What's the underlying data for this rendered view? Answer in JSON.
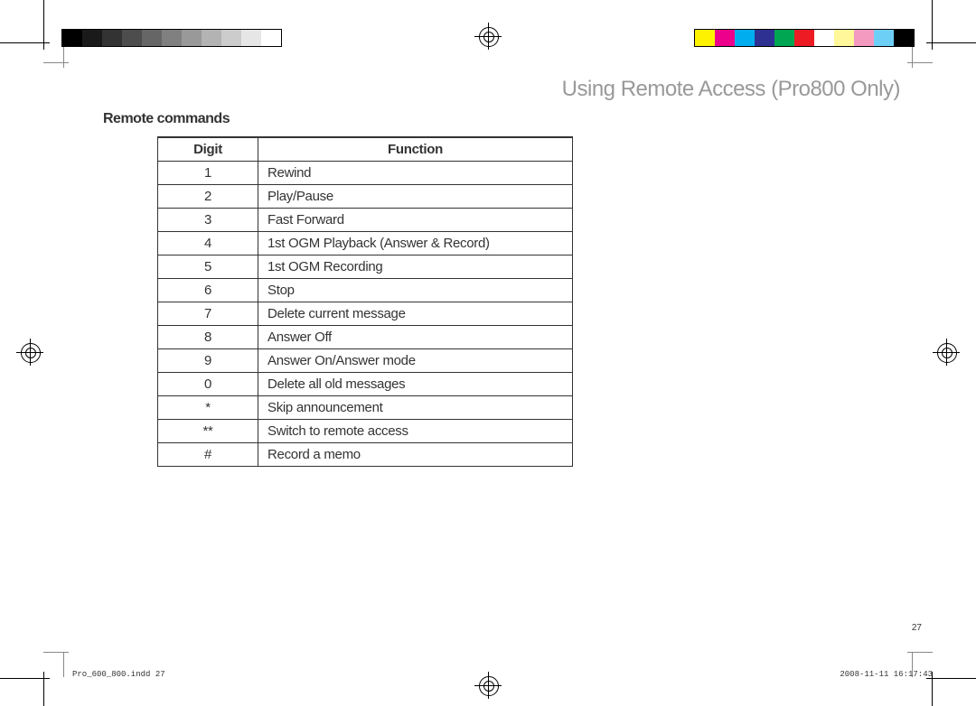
{
  "heading": "Using Remote Access (Pro800 Only)",
  "subheading": "Remote commands",
  "table": {
    "headers": {
      "col1": "Digit",
      "col2": "Function"
    },
    "rows": [
      {
        "digit": "1",
        "func": "Rewind"
      },
      {
        "digit": "2",
        "func": "Play/Pause"
      },
      {
        "digit": "3",
        "func": "Fast Forward"
      },
      {
        "digit": "4",
        "func": "1st OGM Playback (Answer & Record)"
      },
      {
        "digit": "5",
        "func": "1st OGM Recording"
      },
      {
        "digit": "6",
        "func": "Stop"
      },
      {
        "digit": "7",
        "func": "Delete current message"
      },
      {
        "digit": "8",
        "func": "Answer Off"
      },
      {
        "digit": "9",
        "func": "Answer On/Answer mode"
      },
      {
        "digit": "0",
        "func": "Delete all old messages"
      },
      {
        "digit": "*",
        "func": "Skip announcement"
      },
      {
        "digit": "**",
        "func": "Switch to remote access"
      },
      {
        "digit": "#",
        "func": "Record a memo"
      }
    ]
  },
  "page_number": "27",
  "footer": {
    "file": "Pro_600_800.indd   27",
    "timestamp": "2008-11-11   16:17:43"
  }
}
